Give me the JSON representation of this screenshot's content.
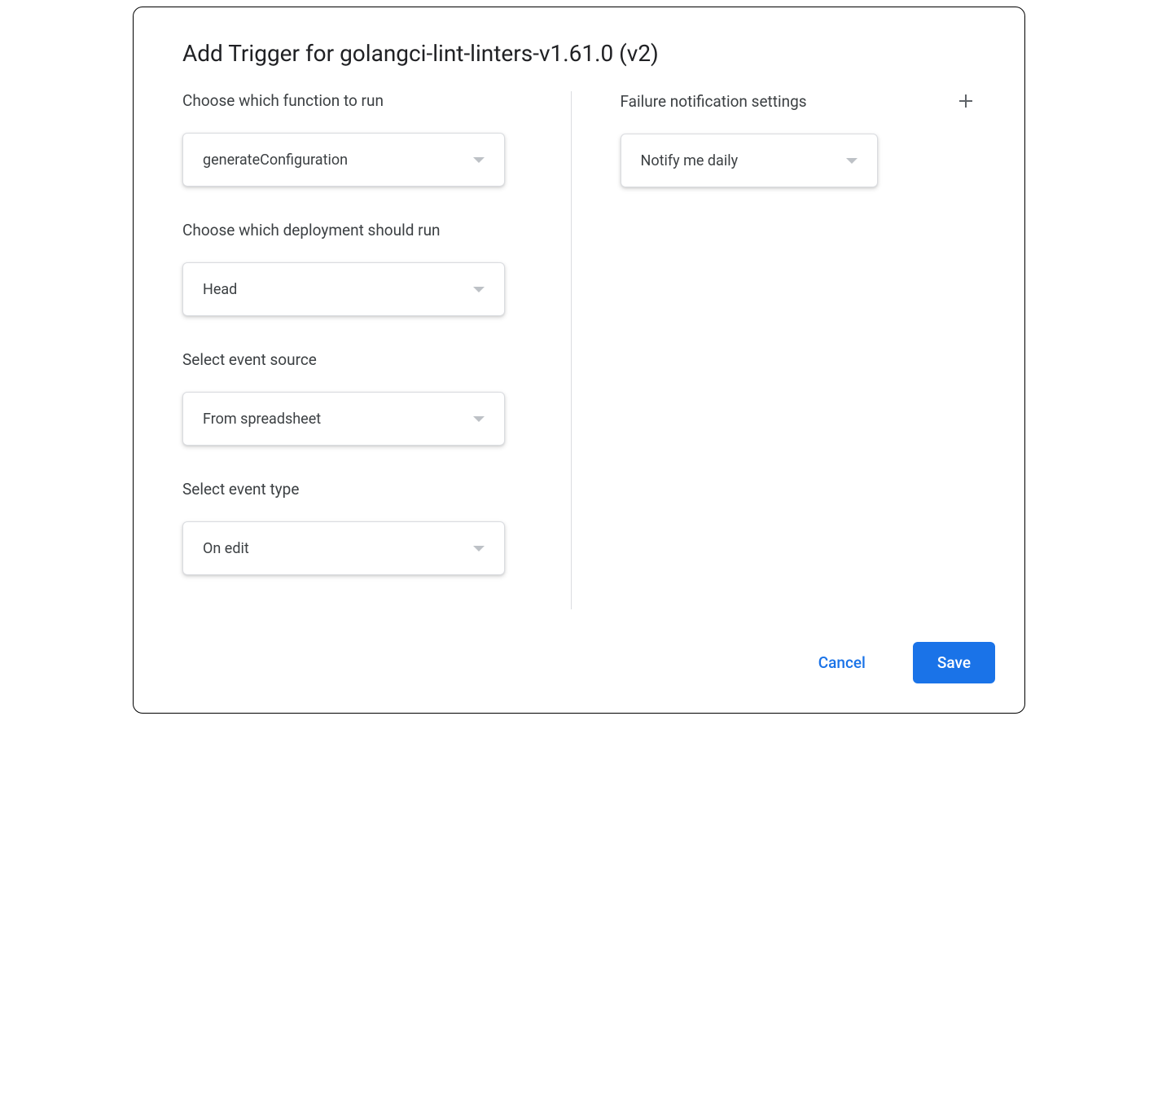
{
  "dialog": {
    "title": "Add Trigger for golangci-lint-linters-v1.61.0 (v2)"
  },
  "left": {
    "function": {
      "label": "Choose which function to run",
      "value": "generateConfiguration"
    },
    "deployment": {
      "label": "Choose which deployment should run",
      "value": "Head"
    },
    "eventSource": {
      "label": "Select event source",
      "value": "From spreadsheet"
    },
    "eventType": {
      "label": "Select event type",
      "value": "On edit"
    }
  },
  "right": {
    "failureNotification": {
      "label": "Failure notification settings",
      "value": "Notify me daily"
    }
  },
  "footer": {
    "cancel": "Cancel",
    "save": "Save"
  }
}
